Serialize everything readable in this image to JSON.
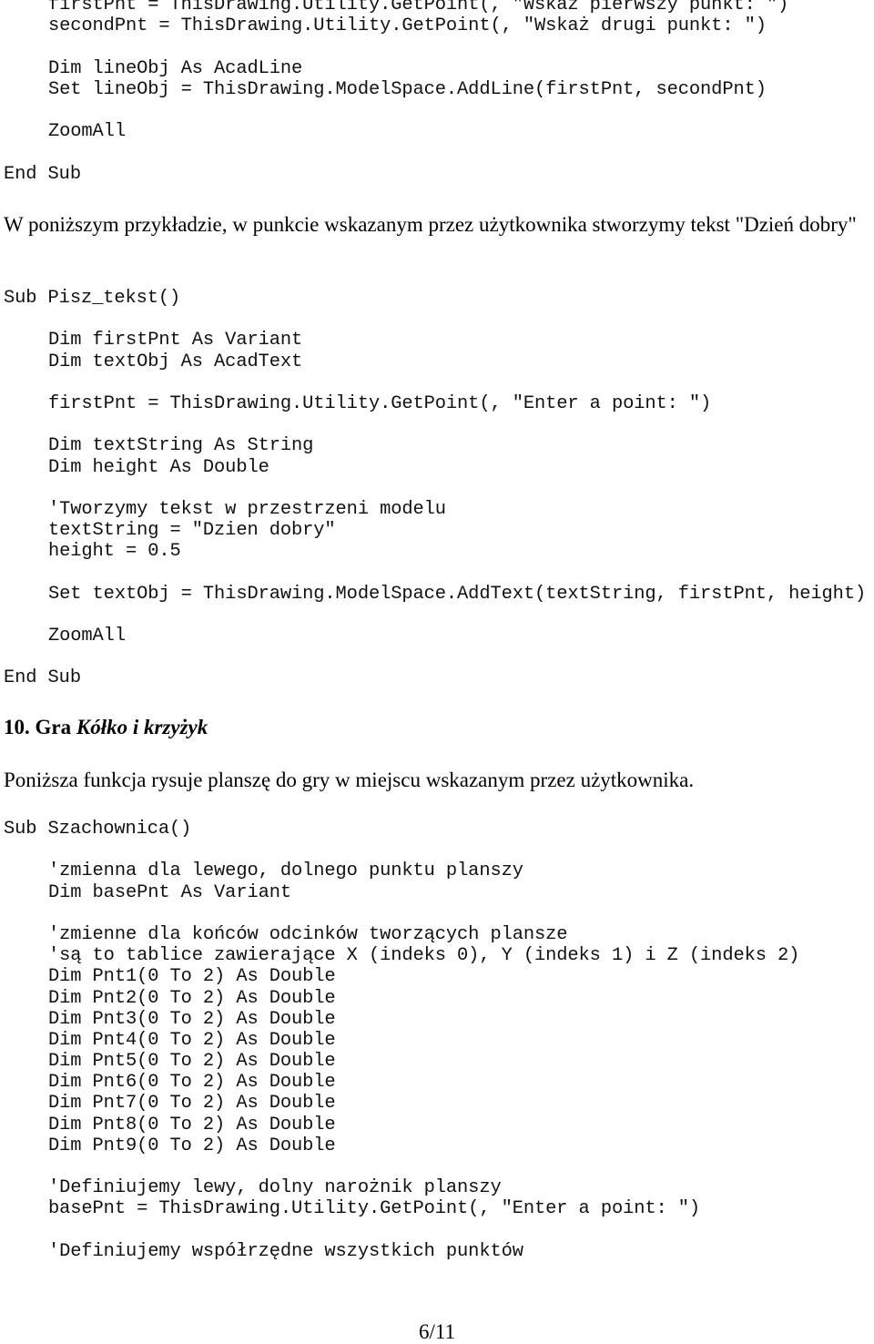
{
  "block1": {
    "lines": [
      {
        "indent": true,
        "text": "firstPnt = ThisDrawing.Utility.GetPoint(, \"Wskaż pierwszy punkt: \")"
      },
      {
        "indent": true,
        "text": "secondPnt = ThisDrawing.Utility.GetPoint(, \"Wskaż drugi punkt: \")"
      },
      {
        "indent": true,
        "text": ""
      },
      {
        "indent": true,
        "text": "Dim lineObj As AcadLine"
      },
      {
        "indent": true,
        "text": "Set lineObj = ThisDrawing.ModelSpace.AddLine(firstPnt, secondPnt)"
      },
      {
        "indent": true,
        "text": ""
      },
      {
        "indent": true,
        "text": "ZoomAll"
      },
      {
        "indent": true,
        "text": ""
      },
      {
        "indent": false,
        "text": "End Sub"
      }
    ]
  },
  "paragraph1": "W poniższym przykładzie, w punkcie wskazanym przez użytkownika stworzymy tekst \"Dzień dobry\"",
  "block2": {
    "lines": [
      {
        "indent": false,
        "text": "Sub Pisz_tekst()"
      },
      {
        "indent": false,
        "text": ""
      },
      {
        "indent": true,
        "text": "Dim firstPnt As Variant"
      },
      {
        "indent": true,
        "text": "Dim textObj As AcadText"
      },
      {
        "indent": true,
        "text": ""
      },
      {
        "indent": true,
        "text": "firstPnt = ThisDrawing.Utility.GetPoint(, \"Enter a point: \")"
      },
      {
        "indent": true,
        "text": ""
      },
      {
        "indent": true,
        "text": "Dim textString As String"
      },
      {
        "indent": true,
        "text": "Dim height As Double"
      },
      {
        "indent": true,
        "text": ""
      },
      {
        "indent": true,
        "text": "'Tworzymy tekst w przestrzeni modelu"
      },
      {
        "indent": true,
        "text": "textString = \"Dzien dobry\""
      },
      {
        "indent": true,
        "text": "height = 0.5"
      },
      {
        "indent": true,
        "text": ""
      },
      {
        "indent": true,
        "text": "Set textObj = ThisDrawing.ModelSpace.AddText(textString, firstPnt, height)"
      },
      {
        "indent": true,
        "text": ""
      },
      {
        "indent": true,
        "text": "ZoomAll"
      },
      {
        "indent": true,
        "text": ""
      },
      {
        "indent": false,
        "text": "End Sub"
      }
    ]
  },
  "section_heading": {
    "number_prefix": "10. Gra ",
    "title_italic": "Kółko i krzyżyk"
  },
  "paragraph2": "Poniższa funkcja rysuje planszę do gry w miejscu wskazanym przez użytkownika.",
  "block3": {
    "lines": [
      {
        "indent": false,
        "text": "Sub Szachownica()"
      },
      {
        "indent": false,
        "text": ""
      },
      {
        "indent": true,
        "text": "'zmienna dla lewego, dolnego punktu planszy"
      },
      {
        "indent": true,
        "text": "Dim basePnt As Variant"
      },
      {
        "indent": true,
        "text": ""
      },
      {
        "indent": true,
        "text": "'zmienne dla końców odcinków tworzących plansze"
      },
      {
        "indent": true,
        "text": "'są to tablice zawierające X (indeks 0), Y (indeks 1) i Z (indeks 2)"
      },
      {
        "indent": true,
        "text": "Dim Pnt1(0 To 2) As Double"
      },
      {
        "indent": true,
        "text": "Dim Pnt2(0 To 2) As Double"
      },
      {
        "indent": true,
        "text": "Dim Pnt3(0 To 2) As Double"
      },
      {
        "indent": true,
        "text": "Dim Pnt4(0 To 2) As Double"
      },
      {
        "indent": true,
        "text": "Dim Pnt5(0 To 2) As Double"
      },
      {
        "indent": true,
        "text": "Dim Pnt6(0 To 2) As Double"
      },
      {
        "indent": true,
        "text": "Dim Pnt7(0 To 2) As Double"
      },
      {
        "indent": true,
        "text": "Dim Pnt8(0 To 2) As Double"
      },
      {
        "indent": true,
        "text": "Dim Pnt9(0 To 2) As Double"
      },
      {
        "indent": true,
        "text": ""
      },
      {
        "indent": true,
        "text": "'Definiujemy lewy, dolny narożnik planszy"
      },
      {
        "indent": true,
        "text": "basePnt = ThisDrawing.Utility.GetPoint(, \"Enter a point: \")"
      },
      {
        "indent": true,
        "text": ""
      },
      {
        "indent": true,
        "text": "'Definiujemy współrzędne wszystkich punktów"
      }
    ]
  },
  "footer": {
    "page_number": "6/11"
  }
}
